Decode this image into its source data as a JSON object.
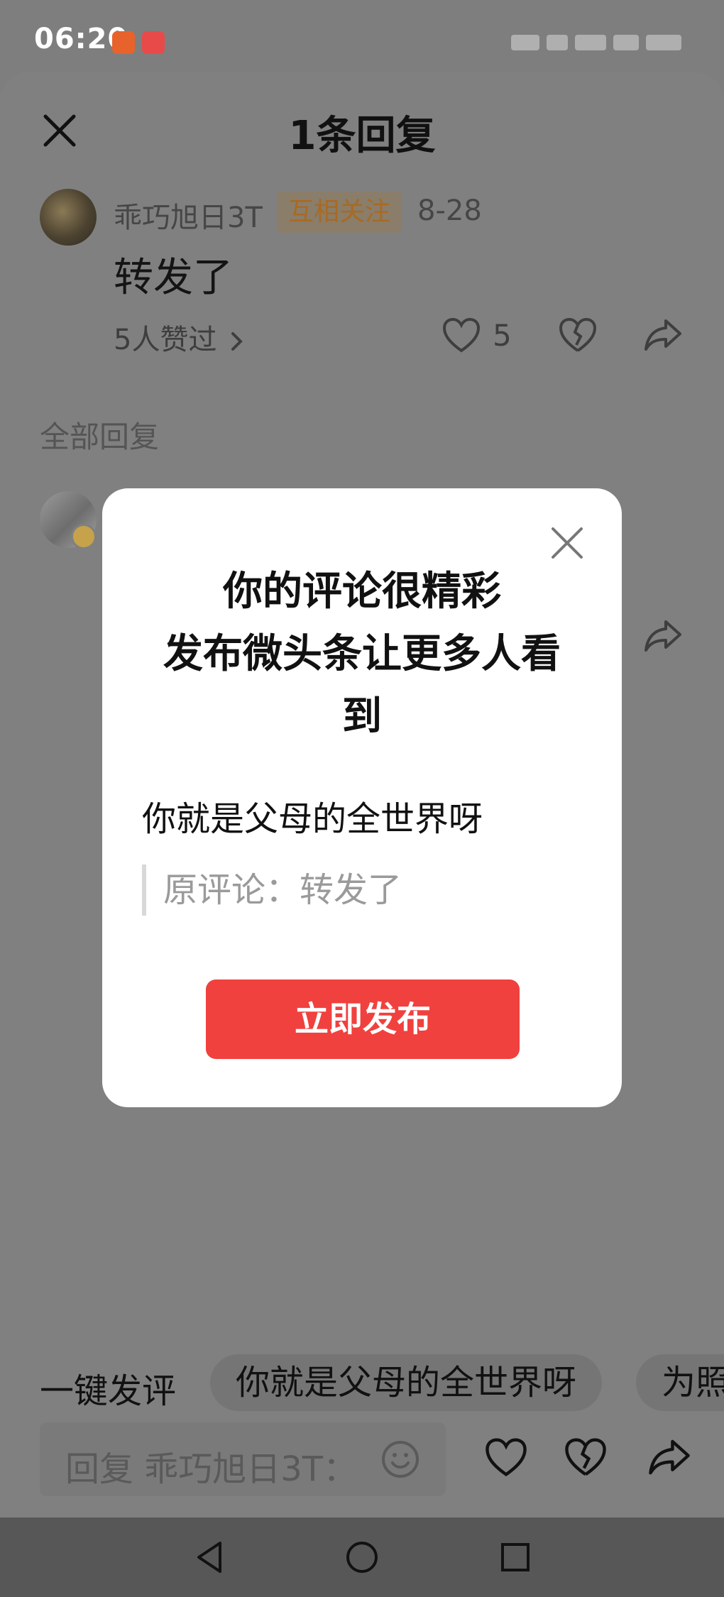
{
  "status_bar": {
    "time": "06:20"
  },
  "sheet": {
    "title": "1条回复",
    "comment": {
      "username": "乖巧旭日3T",
      "relation_tag": "互相关注",
      "date": "8-28",
      "text": "转发了",
      "liked_by": "5人赞过",
      "like_count": "5"
    },
    "section_label": "全部回复"
  },
  "modal": {
    "title_line1": "你的评论很精彩",
    "title_line2": "发布微头条让更多人看",
    "title_line3": "到",
    "body": "你就是父母的全世界呀",
    "quote_label": "原评论：",
    "quote_text": "转发了",
    "publish_button": "立即发布"
  },
  "quick_comments": {
    "label": "一键发评",
    "chips": [
      "你就是父母的全世界呀",
      "为照"
    ]
  },
  "reply_box": {
    "placeholder": "回复 乖巧旭日3T："
  },
  "colors": {
    "primary_button": "#f0413e",
    "overlay": "#808080"
  }
}
